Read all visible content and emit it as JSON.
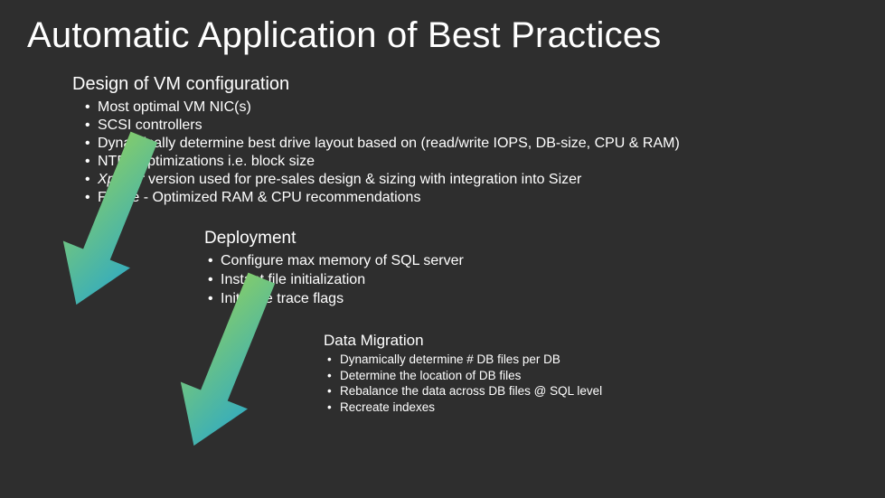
{
  "title": "Automatic Application of Best Practices",
  "section1": {
    "heading": "Design of VM configuration",
    "items": [
      "Most optimal VM NIC(s)",
      "SCSI controllers",
      "Dynamically determine best drive layout based on (read/write IOPS, DB-size, CPU & RAM)",
      "NTFS optimizations i.e. block size",
      "Xplorer version used for pre-sales design & sizing with integration into Sizer",
      "Future - Optimized RAM & CPU recommendations"
    ]
  },
  "section2": {
    "heading": "Deployment",
    "items": [
      "Configure max memory of SQL server",
      "Instant file initialization",
      "Initialize trace flags"
    ]
  },
  "section3": {
    "heading": "Data Migration",
    "items": [
      "Dynamically determine # DB files per DB",
      "Determine the location of DB files",
      "Rebalance the data across DB files @ SQL level",
      "Recreate indexes"
    ]
  },
  "colors": {
    "arrow_start": "#8fd15f",
    "arrow_end": "#2aa8c9"
  }
}
